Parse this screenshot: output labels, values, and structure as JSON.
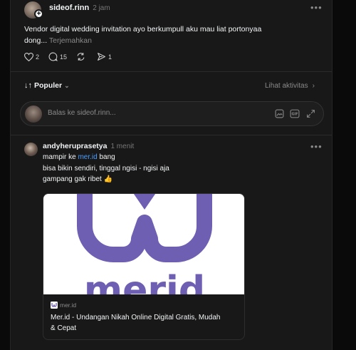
{
  "post": {
    "username": "sideof.rinn",
    "time": "2 jam",
    "text_line1": "Vendor digital wedding invitation ayo berkumpull aku mau liat portonyaa",
    "text_line2": "dong...",
    "translate": "Terjemahkan",
    "likes": "2",
    "comments": "15",
    "reposts": "",
    "shares": "1"
  },
  "sort": {
    "label": "Populer",
    "activity": "Lihat aktivitas"
  },
  "reply": {
    "placeholder": "Balas ke sideof.rinn..."
  },
  "comment": {
    "username": "andyheruprasetya",
    "time": "1 menit",
    "line1_pre": "mampir ke ",
    "line1_link": "mer.id",
    "line1_post": " bang",
    "line2": "bisa bikin sendiri, tinggal ngisi - ngisi aja",
    "line3": "gampang gak ribet 👍"
  },
  "link_card": {
    "domain": "mer.id",
    "title_line1": "Mer.id - Undangan Nikah Online Digital Gratis, Mudah",
    "title_line2": "& Cepat",
    "logo_text": "merid"
  },
  "colors": {
    "background": "#181818",
    "link": "#4a9eff",
    "logo_purple": "#6f5fb3"
  }
}
